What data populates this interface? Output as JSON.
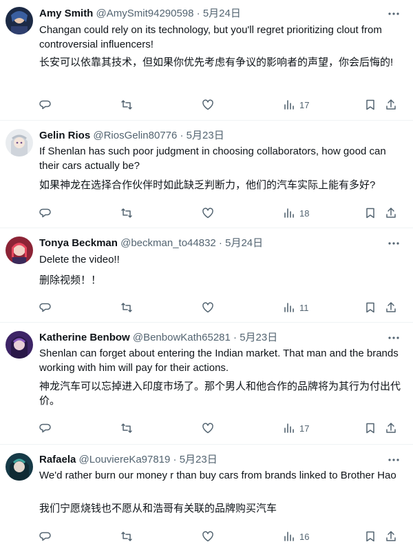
{
  "tweets": [
    {
      "name": "Amy Smith",
      "handle": "@AmySmit94290598",
      "date": "5月24日",
      "text_en": "Changan could rely on its technology, but you'll regret prioritizing clout from controversial influencers!",
      "text_zh": "长安可以依靠其技术，但如果你优先考虑有争议的影响者的声望，你会后悔的!",
      "views": "17",
      "avatar_color": "#2a3b5c"
    },
    {
      "name": "Gelin Rios",
      "handle": "@RiosGelin80776",
      "date": "5月23日",
      "text_en": "If Shenlan has such poor judgment in choosing collaborators, how good can their cars actually be?",
      "text_zh": "如果神龙在选择合作伙伴时如此缺乏判断力，他们的汽车实际上能有多好?",
      "views": "18",
      "avatar_color": "#d9dde3"
    },
    {
      "name": "Tonya Beckman",
      "handle": "@beckman_to44832",
      "date": "5月24日",
      "text_en": "Delete the video!!",
      "text_zh": "删除视频！！",
      "views": "11",
      "avatar_color": "#b23a4a"
    },
    {
      "name": "Katherine Benbow",
      "handle": "@BenbowKath65281",
      "date": "5月23日",
      "text_en": "Shenlan can forget about entering the Indian market. That man and the brands working with him will pay for their actions.",
      "text_zh": "神龙汽车可以忘掉进入印度市场了。那个男人和他合作的品牌将为其行为付出代价。",
      "views": "17",
      "avatar_color": "#5b3a8a"
    },
    {
      "name": "Rafaela",
      "handle": "@LouviereKa97819",
      "date": "5月23日",
      "text_en": "We'd rather burn our money r than buy cars from brands linked to Brother Hao",
      "text_zh": "我们宁愿烧钱也不愿从和浩哥有关联的品牌购买汽车",
      "views": "16",
      "avatar_color": "#1f4a5a"
    }
  ],
  "separator": " · "
}
